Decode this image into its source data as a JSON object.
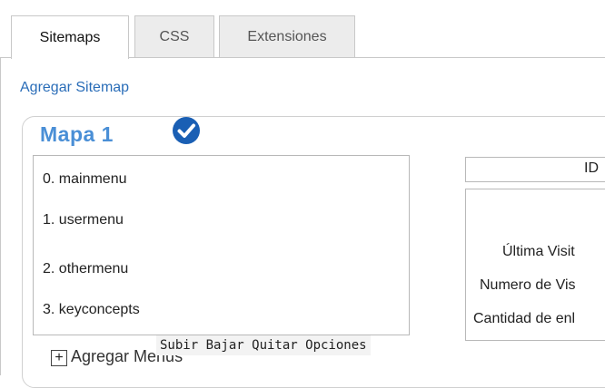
{
  "tabs": [
    "Sitemaps",
    "CSS",
    "Extensiones"
  ],
  "add_sitemap_link": "Agregar Sitemap",
  "map": {
    "title": "Mapa 1",
    "status_icon": "check-circle-icon",
    "menus": [
      "0. mainmenu",
      "1. usermenu",
      "2. othermenu",
      "3. keyconcepts"
    ],
    "list_actions": "Subir Bajar Quitar Opciones",
    "add_menus_icon": "+",
    "add_menus_label": "Agregar Menus",
    "id_label": "ID",
    "info_labels": [
      "Última Visit",
      "Numero de Vis",
      "Cantidad de enl"
    ]
  },
  "colors": {
    "link": "#2a6db8",
    "title": "#4a8fd6",
    "check": "#1a5fb4"
  }
}
